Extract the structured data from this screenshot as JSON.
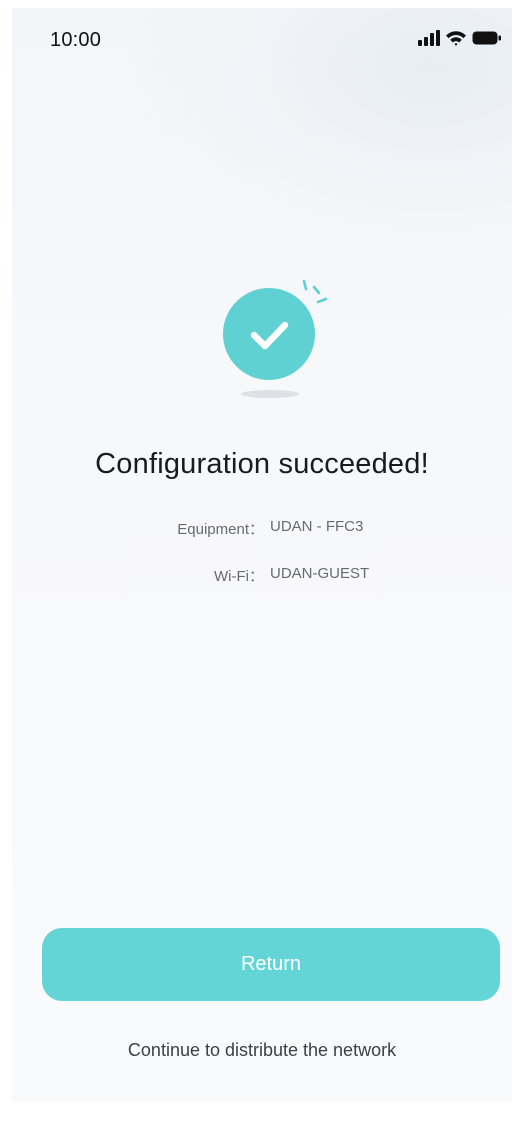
{
  "status_bar": {
    "time": "10:00",
    "icons": [
      "signal-icon",
      "wifi-icon",
      "battery-icon"
    ]
  },
  "success_icon": "checkmark-icon",
  "title": "Configuration succeeded!",
  "details": [
    {
      "label": "Equipment：",
      "value": "UDAN - FFC3"
    },
    {
      "label": "Wi-Fi：",
      "value": "UDAN-GUEST"
    }
  ],
  "actions": {
    "return_label": "Return",
    "continue_label": "Continue to distribute the network"
  },
  "colors": {
    "accent": "#64d5d6",
    "success_circle": "#5fd1d2",
    "title_text": "#1b1b1b",
    "detail_text": "#666b72"
  }
}
